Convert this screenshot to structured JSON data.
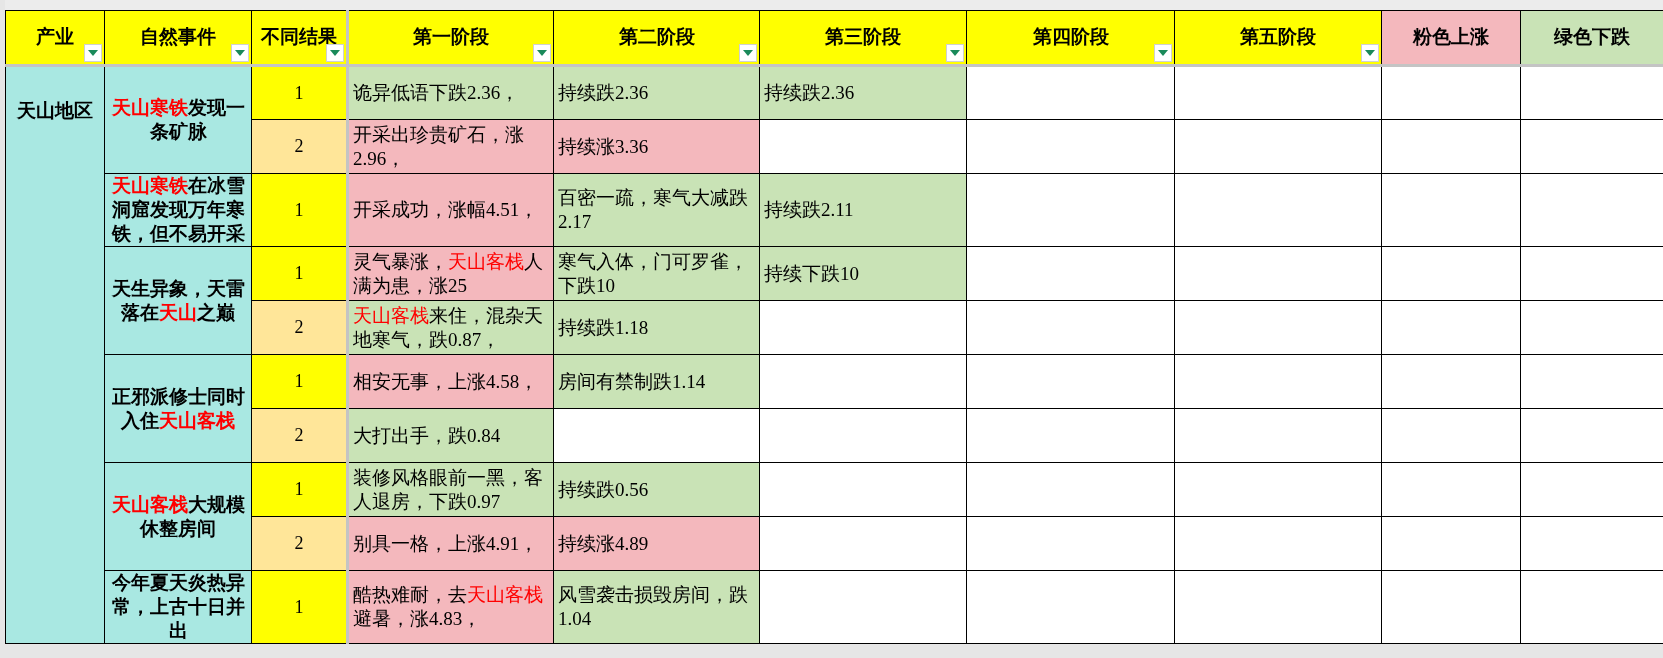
{
  "columns": [
    {
      "label": "产业",
      "filter": true,
      "color": "#ffff00"
    },
    {
      "label": "自然事件",
      "filter": true,
      "color": "#ffff00"
    },
    {
      "label": "不同结果",
      "filter": true,
      "color": "#ffff00"
    },
    {
      "label": "第一阶段",
      "filter": true,
      "color": "#ffff00"
    },
    {
      "label": "第二阶段",
      "filter": true,
      "color": "#ffff00"
    },
    {
      "label": "第三阶段",
      "filter": true,
      "color": "#ffff00"
    },
    {
      "label": "第四阶段",
      "filter": true,
      "color": "#ffff00"
    },
    {
      "label": "第五阶段",
      "filter": true,
      "color": "#ffff00"
    },
    {
      "label": "粉色上涨",
      "filter": false,
      "color": "#f4b8bd"
    },
    {
      "label": "绿色下跌",
      "filter": false,
      "color": "#c9e3b6"
    }
  ],
  "industries": [
    {
      "name": "天山地区",
      "events": [
        {
          "title": [
            {
              "text": "天山寒铁",
              "red": true
            },
            {
              "text": "发现一条矿脉",
              "red": false
            }
          ],
          "results": [
            {
              "label": "1",
              "color": "#ffff00",
              "stages": [
                {
                  "text": "诡异低语下跌2.36，",
                  "rising": false
                },
                {
                  "text": "持续跌2.36",
                  "rising": false
                },
                {
                  "text": "持续跌2.36",
                  "rising": false
                }
              ]
            },
            {
              "label": "2",
              "color": "#ffe699",
              "stages": [
                {
                  "text": "开采出珍贵矿石，涨2.96，",
                  "rising": true
                },
                {
                  "text": "持续涨3.36",
                  "rising": true
                }
              ]
            }
          ]
        },
        {
          "title": [
            {
              "text": "天山寒铁",
              "red": true
            },
            {
              "text": "在冰雪洞窟发现万年寒铁，但不易开采",
              "red": false
            }
          ],
          "results": [
            {
              "label": "1",
              "color": "#ffff00",
              "stages": [
                {
                  "text": "开采成功，涨幅4.51，",
                  "rising": true
                },
                {
                  "text": "百密一疏，寒气大减跌2.17",
                  "rising": false
                },
                {
                  "text": "持续跌2.11",
                  "rising": false
                }
              ]
            }
          ]
        },
        {
          "title": [
            {
              "text": "天生异象，天雷落在",
              "red": false
            },
            {
              "text": "天山",
              "red": true
            },
            {
              "text": "之巅",
              "red": false
            }
          ],
          "results": [
            {
              "label": "1",
              "color": "#ffff00",
              "stages": [
                {
                  "text": [
                    {
                      "text": "灵气暴涨，",
                      "red": false
                    },
                    {
                      "text": "天山客栈",
                      "red": true
                    },
                    {
                      "text": "人满为患，涨25",
                      "red": false
                    }
                  ],
                  "rising": true
                },
                {
                  "text": "寒气入体，门可罗雀，下跌10",
                  "rising": false
                },
                {
                  "text": "持续下跌10",
                  "rising": false
                }
              ]
            },
            {
              "label": "2",
              "color": "#ffe699",
              "stages": [
                {
                  "text": [
                    {
                      "text": "天山客栈",
                      "red": true
                    },
                    {
                      "text": "来住，混杂天地寒气，跌0.87，",
                      "red": false
                    }
                  ],
                  "rising": false
                },
                {
                  "text": "持续跌1.18",
                  "rising": false
                }
              ]
            }
          ]
        },
        {
          "title": [
            {
              "text": "正邪派修士同时入住",
              "red": false
            },
            {
              "text": "天山客栈",
              "red": true
            }
          ],
          "results": [
            {
              "label": "1",
              "color": "#ffff00",
              "stages": [
                {
                  "text": "相安无事，上涨4.58，",
                  "rising": true
                },
                {
                  "text": "房间有禁制跌1.14",
                  "rising": false
                }
              ]
            },
            {
              "label": "2",
              "color": "#ffe699",
              "stages": [
                {
                  "text": "大打出手，跌0.84",
                  "rising": false
                }
              ]
            }
          ]
        },
        {
          "title": [
            {
              "text": "天山客栈",
              "red": true
            },
            {
              "text": "大规模休整房间",
              "red": false
            }
          ],
          "results": [
            {
              "label": "1",
              "color": "#ffff00",
              "stages": [
                {
                  "text": "装修风格眼前一黑，客人退房，下跌0.97",
                  "rising": false
                },
                {
                  "text": "持续跌0.56",
                  "rising": false
                }
              ]
            },
            {
              "label": "2",
              "color": "#ffe699",
              "stages": [
                {
                  "text": "别具一格，上涨4.91，",
                  "rising": true
                },
                {
                  "text": "持续涨4.89",
                  "rising": true
                }
              ]
            }
          ]
        },
        {
          "title": [
            {
              "text": "今年夏天炎热异常，上古十日并出",
              "red": false
            }
          ],
          "results": [
            {
              "label": "1",
              "color": "#ffff00",
              "stages": [
                {
                  "text": [
                    {
                      "text": "酷热难耐，去",
                      "red": false
                    },
                    {
                      "text": "天山客栈",
                      "red": true
                    },
                    {
                      "text": "避暑，涨4.83，",
                      "red": false
                    }
                  ],
                  "rising": true
                },
                {
                  "text": "风雪袭击损毁房间，跌1.04",
                  "rising": false
                }
              ]
            }
          ]
        }
      ]
    }
  ]
}
